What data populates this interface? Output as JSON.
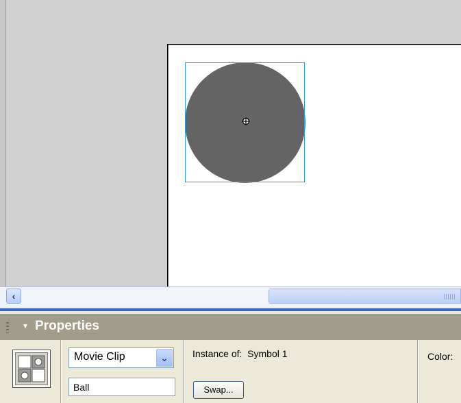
{
  "scrollbar": {
    "left_arrow": "‹"
  },
  "properties_panel": {
    "title": "Properties",
    "collapse_arrow": "▼",
    "symbol_type": "Movie Clip",
    "dropdown_arrow": "⌄",
    "instance_name": "Ball",
    "instance_of_label": "Instance of:",
    "instance_of_value": "Symbol 1",
    "swap_label": "Swap...",
    "color_label": "Color:"
  },
  "icons": {
    "registration": "registration-point-icon",
    "symbol": "movie-clip-symbol-icon"
  },
  "colors": {
    "ball_fill": "#646464",
    "selection": "#2aa3e6",
    "panel_header": "#a29d8b",
    "panel_body": "#ece9d8",
    "accent_blue": "#3d64b6"
  }
}
